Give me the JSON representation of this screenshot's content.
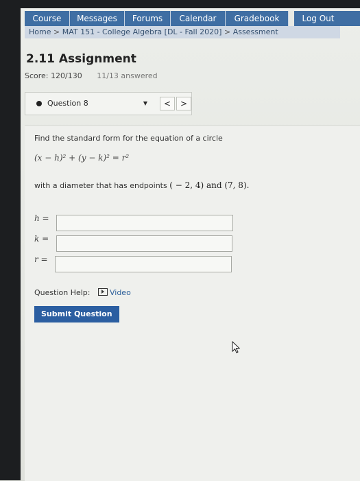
{
  "nav": {
    "items": [
      "Course",
      "Messages",
      "Forums",
      "Calendar",
      "Gradebook"
    ],
    "logout": "Log Out"
  },
  "breadcrumb": {
    "home": "Home",
    "course": "MAT 151 - College Algebra [DL - Fall 2020]",
    "current": "Assessment",
    "separator": ">"
  },
  "assignment": {
    "title": "2.11 Assignment",
    "score": "Score: 120/130",
    "answered": "11/13 answered"
  },
  "question_selector": {
    "selected": "Question 8",
    "prev": "<",
    "next": ">"
  },
  "question": {
    "prompt": "Find the standard form for the equation of a circle",
    "equation": "(x − h)² + (y − k)² = r²",
    "diameter_text": "with a diameter that has endpoints",
    "endpoints": "( − 2, 4) and (7, 8).",
    "fields": [
      {
        "label": "h =",
        "value": ""
      },
      {
        "label": "k =",
        "value": ""
      },
      {
        "label": "r =",
        "value": ""
      }
    ]
  },
  "help": {
    "label": "Question Help:",
    "video": "Video"
  },
  "submit_label": "Submit Question",
  "colors": {
    "nav_bg": "#3f6ea3",
    "submit_bg": "#2b5ea1",
    "link": "#2d5f9a"
  }
}
